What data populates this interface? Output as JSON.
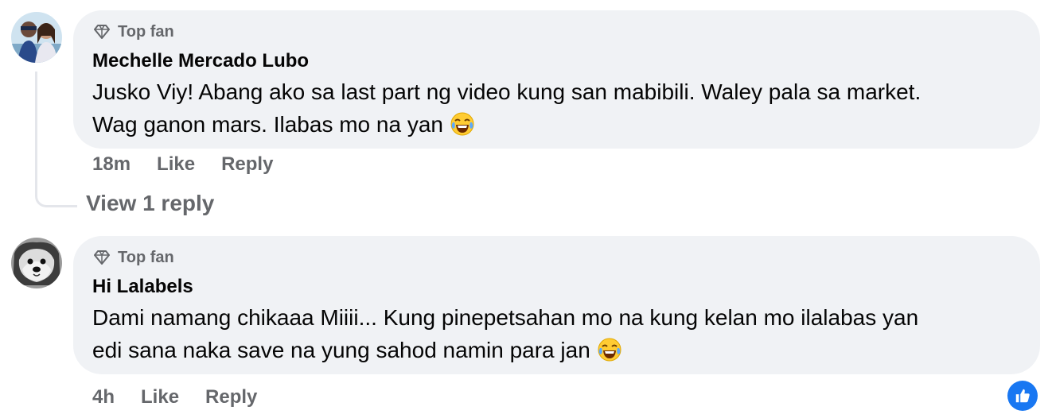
{
  "comments": [
    {
      "badge": "Top fan",
      "author": "Mechelle Mercado Lubo",
      "text_line1": "Jusko Viy! Abang ako sa last part ng video kung san mabibili. Waley pala sa market.",
      "text_line2": "Wag ganon mars. Ilabas mo na yan",
      "time": "18m",
      "like": "Like",
      "reply": "Reply",
      "view_replies": "View 1 reply"
    },
    {
      "badge": "Top fan",
      "author": "Hi Lalabels",
      "text_line1": "Dami namang chikaaa Miiii... Kung pinepetsahan mo na kung kelan mo ilalabas yan",
      "text_line2": "edi sana naka save na yung sahod namin para jan",
      "time": "4h",
      "like": "Like",
      "reply": "Reply"
    }
  ],
  "colors": {
    "bubble": "#f0f2f5",
    "secondary_text": "#65676b",
    "primary_text": "#050505",
    "like_blue": "#1877f2"
  },
  "icons": {
    "badge": "diamond-icon",
    "emoji": "face-with-tears-of-joy-emoji",
    "reaction": "thumbs-up-icon"
  }
}
